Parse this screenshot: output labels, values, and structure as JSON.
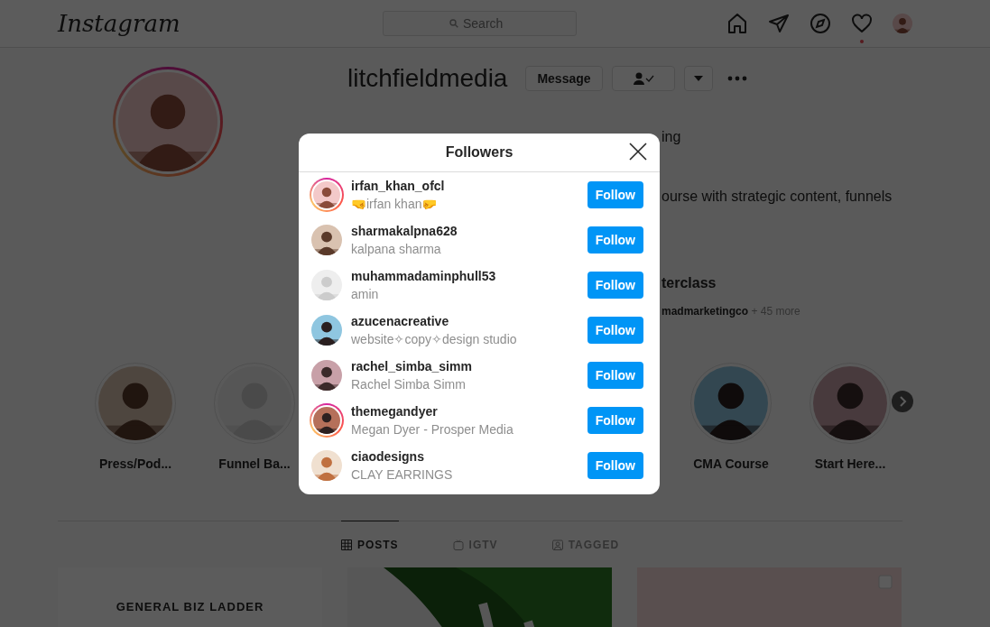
{
  "top_bar": {
    "logo": "Instagram",
    "search": {
      "placeholder": "Search"
    },
    "activity_dot": true
  },
  "profile": {
    "username": "litchfieldmedia",
    "message_button": "Message",
    "visible_fragments": [
      {
        "kind": "stat",
        "text": "ing"
      },
      {
        "kind": "bio",
        "text": "ourse with strategic content, funnels"
      },
      {
        "kind": "title",
        "text": "terclass"
      },
      {
        "kind": "followed",
        "text": "madmarketingco",
        "more": "+ 45 more"
      }
    ]
  },
  "highlights": {
    "left": [
      {
        "label": "Press/Pod..."
      },
      {
        "label": "Funnel Ba..."
      }
    ],
    "right": [
      {
        "label": "CMA Course"
      },
      {
        "label": "Start Here..."
      }
    ]
  },
  "tabs": [
    {
      "label": "POSTS",
      "selected": true
    },
    {
      "label": "IGTV",
      "selected": false
    },
    {
      "label": "TAGGED",
      "selected": false
    }
  ],
  "posts": [
    {
      "kind": "text",
      "text": "GENERAL BIZ LADDER"
    },
    {
      "kind": "picture"
    },
    {
      "kind": "pink"
    }
  ],
  "modal": {
    "title": "Followers",
    "rows": [
      {
        "username": "irfan_khan_ofcl",
        "name": "🤜irfan khan🤛",
        "story_ring": true,
        "button": "Follow"
      },
      {
        "username": "sharmakalpna628",
        "name": "kalpana sharma",
        "story_ring": false,
        "button": "Follow"
      },
      {
        "username": "muhammadaminphull53",
        "name": "amin",
        "story_ring": false,
        "button": "Follow"
      },
      {
        "username": "azucenacreative",
        "name": "website✧copy✧design studio",
        "story_ring": false,
        "button": "Follow"
      },
      {
        "username": "rachel_simba_simm",
        "name": "Rachel Simba Simm",
        "story_ring": false,
        "button": "Follow"
      },
      {
        "username": "themegandyer",
        "name": "Megan Dyer - Prosper Media",
        "story_ring": true,
        "button": "Follow"
      },
      {
        "username": "ciaodesigns",
        "name": "CLAY EARRINGS",
        "story_ring": false,
        "button": "Follow"
      }
    ]
  }
}
